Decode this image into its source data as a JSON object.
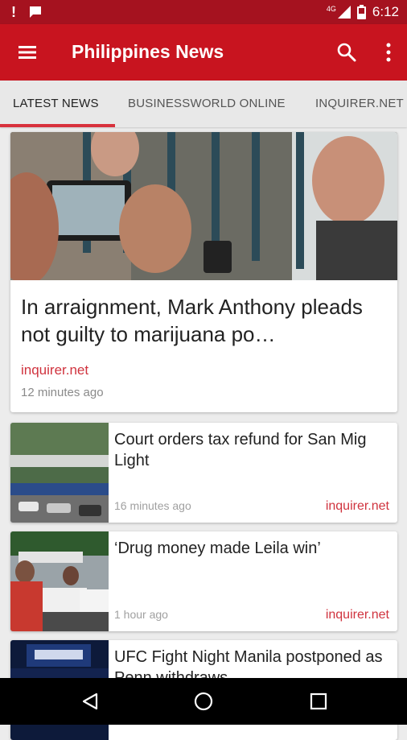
{
  "status": {
    "network": "4G",
    "time": "6:12"
  },
  "app": {
    "title": "Philippines News"
  },
  "tabs": [
    "LATEST NEWS",
    "BUSINESSWORLD ONLINE",
    "INQUIRER.NET"
  ],
  "hero": {
    "title": "In arraignment, Mark Anthony pleads not guilty to marijuana po…",
    "source": "inquirer.net",
    "time": "12 minutes ago"
  },
  "articles": [
    {
      "title": "Court orders tax refund for San Mig Light",
      "time": "16 minutes ago",
      "source": "inquirer.net"
    },
    {
      "title": "‘Drug money made Leila win’",
      "time": "1 hour ago",
      "source": "inquirer.net"
    },
    {
      "title": "UFC Fight Night Manila postponed as Penn withdraws",
      "time": "",
      "source": ""
    }
  ],
  "colors": {
    "primary": "#c8141f",
    "status_bar": "#a5121f",
    "accent": "#d0333e"
  }
}
